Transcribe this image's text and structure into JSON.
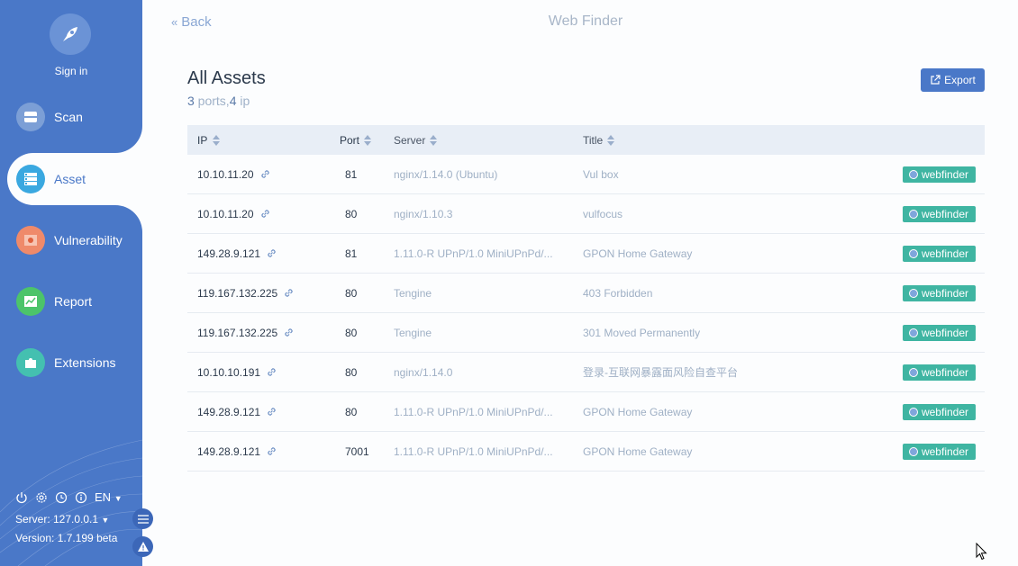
{
  "sidebar": {
    "sign_in": "Sign in",
    "nav": [
      {
        "label": "Scan",
        "icon": "scan-icon",
        "color": "#7c9fd6"
      },
      {
        "label": "Asset",
        "icon": "asset-icon",
        "color": "#3aa8e0"
      },
      {
        "label": "Vulnerability",
        "icon": "bug-icon",
        "color": "#ef8a6a"
      },
      {
        "label": "Report",
        "icon": "report-icon",
        "color": "#4cc46a"
      },
      {
        "label": "Extensions",
        "icon": "puzzle-icon",
        "color": "#44c0b0"
      }
    ],
    "language": "EN",
    "server": "Server: 127.0.0.1",
    "version": "Version: 1.7.199 beta"
  },
  "header": {
    "back": "Back",
    "app_title": "Web Finder"
  },
  "main": {
    "title": "All Assets",
    "ports_count": "3",
    "ports_label": " ports,",
    "ip_count": "4",
    "ip_label": " ip",
    "export_label": "Export"
  },
  "table": {
    "columns": [
      "IP",
      "Port",
      "Server",
      "Title"
    ],
    "rows": [
      {
        "ip": "10.10.11.20",
        "port": "81",
        "server": "nginx/1.14.0 (Ubuntu)",
        "title": "Vul box",
        "tag": "webfinder"
      },
      {
        "ip": "10.10.11.20",
        "port": "80",
        "server": "nginx/1.10.3",
        "title": "vulfocus",
        "tag": "webfinder"
      },
      {
        "ip": "149.28.9.121",
        "port": "81",
        "server": "1.11.0-R UPnP/1.0 MiniUPnPd/...",
        "title": "GPON Home Gateway",
        "tag": "webfinder"
      },
      {
        "ip": "119.167.132.225",
        "port": "80",
        "server": "Tengine",
        "title": "403 Forbidden",
        "tag": "webfinder"
      },
      {
        "ip": "119.167.132.225",
        "port": "80",
        "server": "Tengine",
        "title": "301 Moved Permanently",
        "tag": "webfinder"
      },
      {
        "ip": "10.10.10.191",
        "port": "80",
        "server": "nginx/1.14.0",
        "title": "登录-互联网暴露面风险自查平台",
        "tag": "webfinder"
      },
      {
        "ip": "149.28.9.121",
        "port": "80",
        "server": "1.11.0-R UPnP/1.0 MiniUPnPd/...",
        "title": "GPON Home Gateway",
        "tag": "webfinder"
      },
      {
        "ip": "149.28.9.121",
        "port": "7001",
        "server": "1.11.0-R UPnP/1.0 MiniUPnPd/...",
        "title": "GPON Home Gateway",
        "tag": "webfinder"
      }
    ]
  },
  "colors": {
    "sidebar": "#4a78c8",
    "accent": "#4a78c8",
    "tag": "#3fb5a2"
  }
}
